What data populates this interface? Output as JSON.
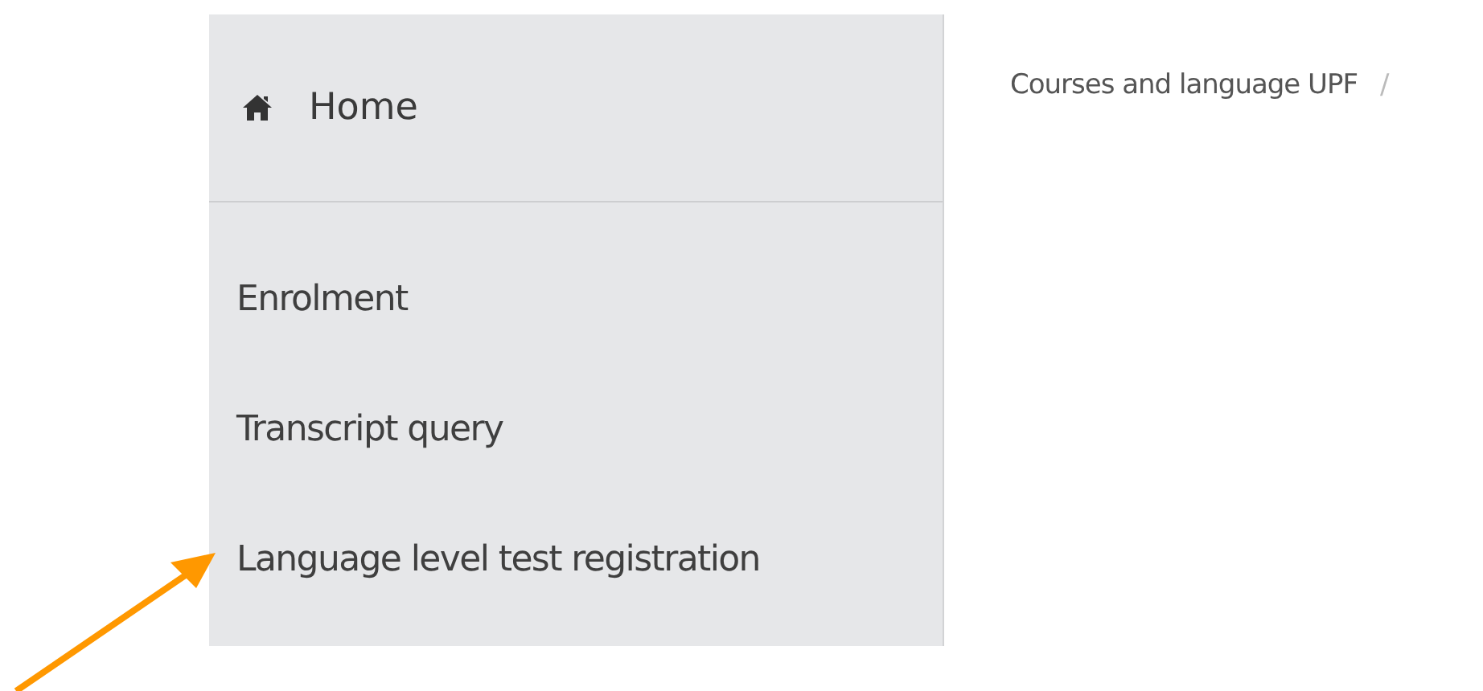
{
  "sidebar": {
    "home": {
      "label": "Home"
    },
    "items": [
      {
        "label": "Enrolment"
      },
      {
        "label": "Transcript query"
      },
      {
        "label": "Language level test registration"
      }
    ]
  },
  "breadcrumb": {
    "items": [
      "Courses and language UPF"
    ],
    "separator": "/"
  }
}
